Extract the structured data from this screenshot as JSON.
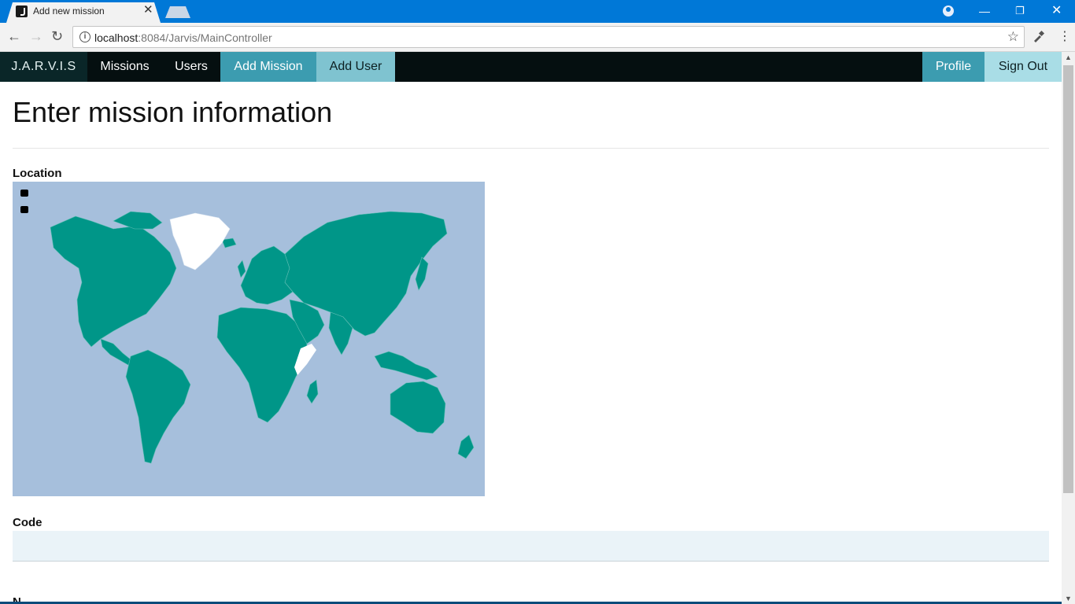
{
  "browser": {
    "tab_title": "Add new mission",
    "url_host": "localhost",
    "url_path": ":8084/Jarvis/MainController"
  },
  "navbar": {
    "brand": "J.A.R.V.I.S",
    "items": [
      "Missions",
      "Users",
      "Add Mission",
      "Add User"
    ],
    "active": "Add Mission",
    "right_items": [
      "Profile",
      "Sign Out"
    ]
  },
  "page": {
    "title": "Enter mission information",
    "location_label": "Location",
    "code_label": "Code",
    "code_value": "",
    "next_label_partial": "N"
  },
  "map": {
    "ocean_color": "#a6bfdc",
    "land_color": "#009688",
    "selected_land_color": "#ffffff",
    "zoom_controls": [
      "zoom-in",
      "zoom-out"
    ]
  },
  "colors": {
    "navbar_bg": "#050f10",
    "active_tab_bg": "#3c9cb0",
    "chrome_blue": "#0078d7"
  }
}
